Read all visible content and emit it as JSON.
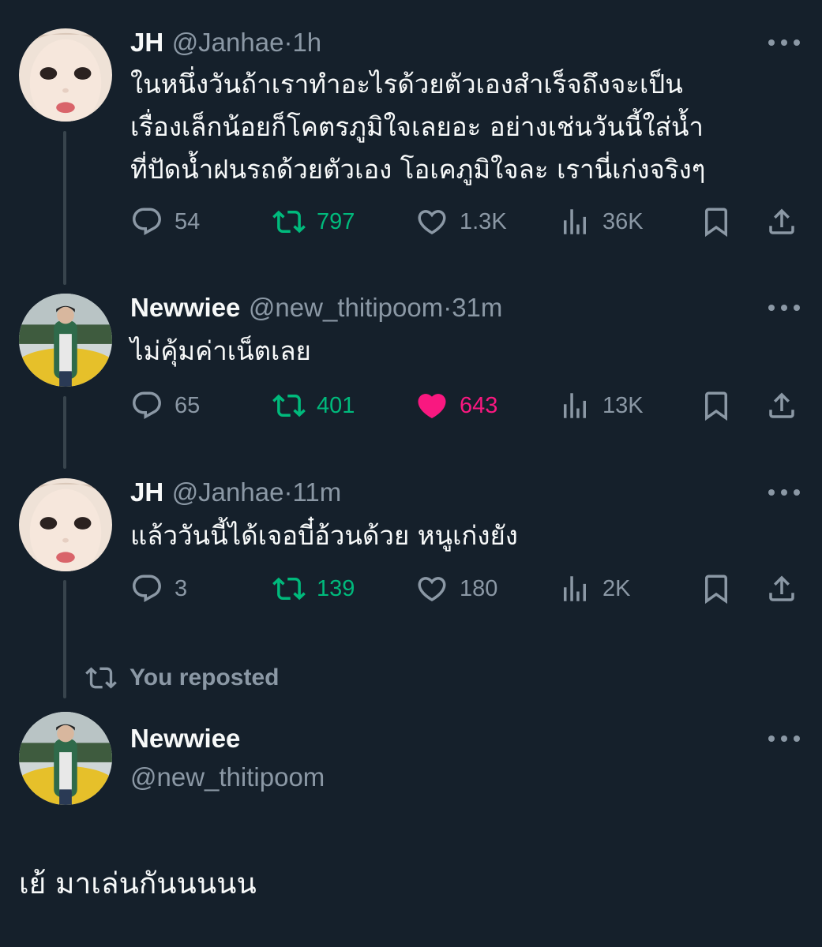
{
  "tweets": [
    {
      "name": "JH",
      "handle": "@Janhae",
      "time": "1h",
      "lines": [
        "ในหนึ่งวันถ้าเราทำอะไรด้วยตัวเองสำเร็จถึงจะเป็น",
        "เรื่องเล็กน้อยก็โคตรภูมิใจเลยอะ อย่างเช่นวันนี้ใส่น้ำ",
        "ที่ปัดน้ำฝนรถด้วยตัวเอง โอเคภูมิใจละ เรานี่เก่งจริงๆ"
      ],
      "replies": "54",
      "reposts": "797",
      "likes": "1.3K",
      "views": "36K",
      "reposted_by_me": true,
      "liked_by_me": false
    },
    {
      "name": "Newwiee",
      "handle": "@new_thitipoom",
      "time": "31m",
      "lines": [
        "ไม่คุ้มค่าเน็ตเลย"
      ],
      "replies": "65",
      "reposts": "401",
      "likes": "643",
      "views": "13K",
      "reposted_by_me": true,
      "liked_by_me": true
    },
    {
      "name": "JH",
      "handle": "@Janhae",
      "time": "11m",
      "lines": [
        "แล้ววันนี้ได้เจอบี๋อ้วนด้วย หนูเก่งยัง"
      ],
      "replies": "3",
      "reposts": "139",
      "likes": "180",
      "views": "2K",
      "reposted_by_me": true,
      "liked_by_me": false
    }
  ],
  "repost_note": "You reposted",
  "main_tweet": {
    "name": "Newwiee",
    "handle": "@new_thitipoom",
    "text": "เย้ มาเล่นกันนนนน"
  },
  "separator": "·",
  "icons": [
    "reply-icon",
    "repost-icon",
    "like-icon",
    "views-icon",
    "bookmark-icon",
    "share-icon",
    "more-icon"
  ],
  "colors": {
    "background": "#15202b",
    "text": "#f7f9f9",
    "muted": "#8b98a5",
    "repost_green": "#00ba7c",
    "like_pink": "#f91880"
  }
}
